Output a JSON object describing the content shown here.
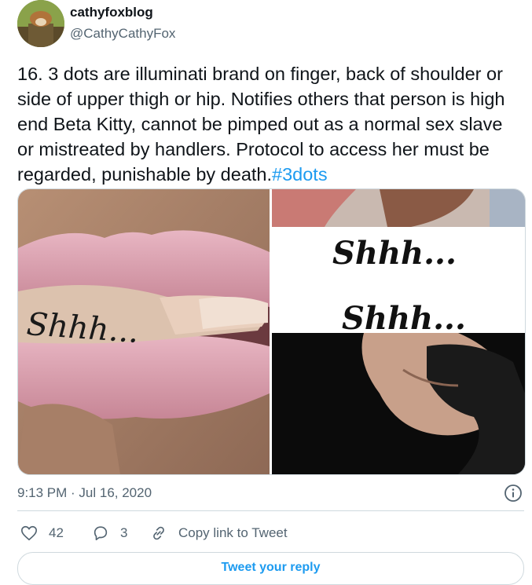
{
  "author": {
    "name": "cathyfoxblog",
    "handle": "@CathyCathyFox"
  },
  "tweet": {
    "text": "16. 3 dots are illuminati brand on finger, back of shoulder or side of upper thigh or hip. Notifies others that person is high end Beta Kitty, cannot be pimped out as a normal sex slave or mistreated by handlers. Protocol to access her must be regarded, punishable by death.",
    "hashtag": "#3dots",
    "timestamp": "9:13 PM · Jul 16, 2020"
  },
  "media": {
    "tattoo_text_1": "Shhh...",
    "tattoo_text_2": "Shhh...",
    "tattoo_text_3": "Shhh..."
  },
  "actions": {
    "likes": "42",
    "replies": "3",
    "copy_link": "Copy link to Tweet",
    "reply_button": "Tweet your reply"
  },
  "icons": [
    "heart-icon",
    "reply-bubble-icon",
    "link-icon",
    "info-icon"
  ],
  "colors": {
    "link": "#1d9bf0",
    "secondary_text": "#536471",
    "border": "#cfd9de"
  }
}
